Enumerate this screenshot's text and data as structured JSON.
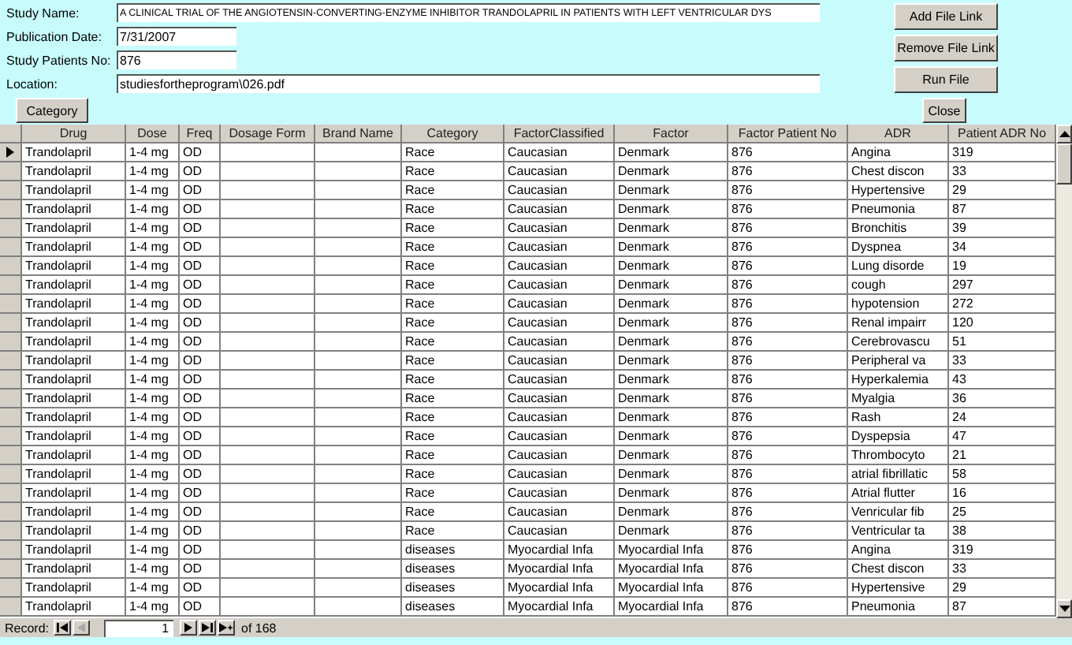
{
  "fields": [
    {
      "label": "Study Name:",
      "value": "A CLINICAL TRIAL OF THE ANGIOTENSIN-CONVERTING-ENZYME INHIBITOR TRANDOLAPRIL IN PATIENTS WITH LEFT VENTRICULAR DYS"
    },
    {
      "label": "Publication Date:",
      "value": "7/31/2007"
    },
    {
      "label": "Study Patients No:",
      "value": "876"
    },
    {
      "label": "Location:",
      "value": "studiesfortheprogram\\026.pdf"
    }
  ],
  "side_buttons": [
    "Add File Link",
    "Remove File Link",
    "Run File"
  ],
  "category_button": "Category",
  "close_button": "Close",
  "grid": {
    "columns": [
      "Drug",
      "Dose",
      "Freq",
      "Dosage Form",
      "Brand Name",
      "Category",
      "FactorClassified",
      "Factor",
      "Factor Patient No",
      "ADR",
      "Patient ADR No"
    ],
    "rows": [
      {
        "current": true,
        "cells": [
          "Trandolapril",
          "1-4 mg",
          "OD",
          "",
          "",
          "Race",
          "Caucasian",
          "Denmark",
          "876",
          "Angina",
          "319"
        ]
      },
      {
        "current": false,
        "cells": [
          "Trandolapril",
          "1-4 mg",
          "OD",
          "",
          "",
          "Race",
          "Caucasian",
          "Denmark",
          "876",
          "Chest discon",
          "33"
        ]
      },
      {
        "current": false,
        "cells": [
          "Trandolapril",
          "1-4 mg",
          "OD",
          "",
          "",
          "Race",
          "Caucasian",
          "Denmark",
          "876",
          "Hypertensive",
          "29"
        ]
      },
      {
        "current": false,
        "cells": [
          "Trandolapril",
          "1-4 mg",
          "OD",
          "",
          "",
          "Race",
          "Caucasian",
          "Denmark",
          "876",
          "Pneumonia",
          "87"
        ]
      },
      {
        "current": false,
        "cells": [
          "Trandolapril",
          "1-4 mg",
          "OD",
          "",
          "",
          "Race",
          "Caucasian",
          "Denmark",
          "876",
          "Bronchitis",
          "39"
        ]
      },
      {
        "current": false,
        "cells": [
          "Trandolapril",
          "1-4 mg",
          "OD",
          "",
          "",
          "Race",
          "Caucasian",
          "Denmark",
          "876",
          "Dyspnea",
          "34"
        ]
      },
      {
        "current": false,
        "cells": [
          "Trandolapril",
          "1-4 mg",
          "OD",
          "",
          "",
          "Race",
          "Caucasian",
          "Denmark",
          "876",
          "Lung disorde",
          "19"
        ]
      },
      {
        "current": false,
        "cells": [
          "Trandolapril",
          "1-4 mg",
          "OD",
          "",
          "",
          "Race",
          "Caucasian",
          "Denmark",
          "876",
          "cough",
          "297"
        ]
      },
      {
        "current": false,
        "cells": [
          "Trandolapril",
          "1-4 mg",
          "OD",
          "",
          "",
          "Race",
          "Caucasian",
          "Denmark",
          "876",
          "hypotension",
          "272"
        ]
      },
      {
        "current": false,
        "cells": [
          "Trandolapril",
          "1-4 mg",
          "OD",
          "",
          "",
          "Race",
          "Caucasian",
          "Denmark",
          "876",
          "Renal impairr",
          "120"
        ]
      },
      {
        "current": false,
        "cells": [
          "Trandolapril",
          "1-4 mg",
          "OD",
          "",
          "",
          "Race",
          "Caucasian",
          "Denmark",
          "876",
          "Cerebrovascu",
          "51"
        ]
      },
      {
        "current": false,
        "cells": [
          "Trandolapril",
          "1-4 mg",
          "OD",
          "",
          "",
          "Race",
          "Caucasian",
          "Denmark",
          "876",
          "Peripheral va",
          "33"
        ]
      },
      {
        "current": false,
        "cells": [
          "Trandolapril",
          "1-4 mg",
          "OD",
          "",
          "",
          "Race",
          "Caucasian",
          "Denmark",
          "876",
          "Hyperkalemia",
          "43"
        ]
      },
      {
        "current": false,
        "cells": [
          "Trandolapril",
          "1-4 mg",
          "OD",
          "",
          "",
          "Race",
          "Caucasian",
          "Denmark",
          "876",
          "Myalgia",
          "36"
        ]
      },
      {
        "current": false,
        "cells": [
          "Trandolapril",
          "1-4 mg",
          "OD",
          "",
          "",
          "Race",
          "Caucasian",
          "Denmark",
          "876",
          "Rash",
          "24"
        ]
      },
      {
        "current": false,
        "cells": [
          "Trandolapril",
          "1-4 mg",
          "OD",
          "",
          "",
          "Race",
          "Caucasian",
          "Denmark",
          "876",
          "Dyspepsia",
          "47"
        ]
      },
      {
        "current": false,
        "cells": [
          "Trandolapril",
          "1-4 mg",
          "OD",
          "",
          "",
          "Race",
          "Caucasian",
          "Denmark",
          "876",
          "Thrombocyto",
          "21"
        ]
      },
      {
        "current": false,
        "cells": [
          "Trandolapril",
          "1-4 mg",
          "OD",
          "",
          "",
          "Race",
          "Caucasian",
          "Denmark",
          "876",
          "atrial fibrillatic",
          "58"
        ]
      },
      {
        "current": false,
        "cells": [
          "Trandolapril",
          "1-4 mg",
          "OD",
          "",
          "",
          "Race",
          "Caucasian",
          "Denmark",
          "876",
          "Atrial flutter",
          "16"
        ]
      },
      {
        "current": false,
        "cells": [
          "Trandolapril",
          "1-4 mg",
          "OD",
          "",
          "",
          "Race",
          "Caucasian",
          "Denmark",
          "876",
          "Venricular fib",
          "25"
        ]
      },
      {
        "current": false,
        "cells": [
          "Trandolapril",
          "1-4 mg",
          "OD",
          "",
          "",
          "Race",
          "Caucasian",
          "Denmark",
          "876",
          "Ventricular ta",
          "38"
        ]
      },
      {
        "current": false,
        "cells": [
          "Trandolapril",
          "1-4 mg",
          "OD",
          "",
          "",
          "diseases",
          "Myocardial Infa",
          "Myocardial Infa",
          "876",
          "Angina",
          "319"
        ]
      },
      {
        "current": false,
        "cells": [
          "Trandolapril",
          "1-4 mg",
          "OD",
          "",
          "",
          "diseases",
          "Myocardial Infa",
          "Myocardial Infa",
          "876",
          "Chest discon",
          "33"
        ]
      },
      {
        "current": false,
        "cells": [
          "Trandolapril",
          "1-4 mg",
          "OD",
          "",
          "",
          "diseases",
          "Myocardial Infa",
          "Myocardial Infa",
          "876",
          "Hypertensive",
          "29"
        ]
      },
      {
        "current": false,
        "cells": [
          "Trandolapril",
          "1-4 mg",
          "OD",
          "",
          "",
          "diseases",
          "Myocardial Infa",
          "Myocardial Infa",
          "876",
          "Pneumonia",
          "87"
        ]
      }
    ]
  },
  "record_nav": {
    "label": "Record:",
    "current": "1",
    "total": "of 168"
  }
}
